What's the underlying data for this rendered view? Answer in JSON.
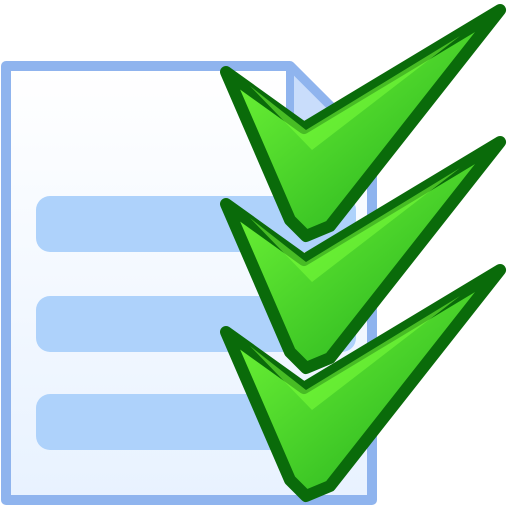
{
  "icon": {
    "name": "checklist-icon",
    "document_colors": {
      "fill_top": "#ffffff",
      "fill_bottom": "#e8f2ff",
      "border": "#8fb4ee",
      "fold": "#c9ddfb",
      "line_fill": "#aed2fb"
    },
    "checkmark_colors": {
      "outline": "#0a6b0a",
      "fill_light": "#7aff3a",
      "fill_dark": "#1aa61a"
    },
    "lines": [
      {
        "name": "document-line-1"
      },
      {
        "name": "document-line-2"
      },
      {
        "name": "document-line-3"
      }
    ],
    "checkmarks": [
      {
        "name": "checkmark-icon-1"
      },
      {
        "name": "checkmark-icon-2"
      },
      {
        "name": "checkmark-icon-3"
      }
    ]
  }
}
